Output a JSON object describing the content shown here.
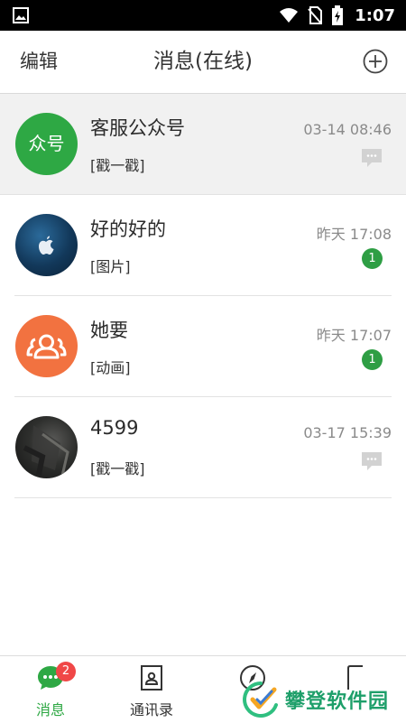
{
  "status_bar": {
    "time": "1:07"
  },
  "header": {
    "edit_label": "编辑",
    "title": "消息(在线)"
  },
  "conversations": [
    {
      "name": "客服公众号",
      "avatar_text": "众号",
      "preview": "[戳一戳]",
      "time": "03-14 08:46",
      "unread": null,
      "pinned": true,
      "avatar_color": "#2ea844"
    },
    {
      "name": "好的好的",
      "preview": "[图片]",
      "time": "昨天 17:08",
      "unread": "1",
      "pinned": false
    },
    {
      "name": "她要",
      "preview": "[动画]",
      "time": "昨天 17:07",
      "unread": "1",
      "pinned": false,
      "avatar_color": "#f27240"
    },
    {
      "name": "4599",
      "preview": "[戳一戳]",
      "time": "03-17 15:39",
      "unread": null,
      "pinned": false
    }
  ],
  "tabs": [
    {
      "label": "消息",
      "badge": "2",
      "active": true
    },
    {
      "label": "通讯录"
    }
  ],
  "watermark": {
    "text": "攀登软件园"
  },
  "colors": {
    "accent": "#2ea844",
    "badge_red": "#f04747",
    "unread_green": "#2e9e44"
  }
}
